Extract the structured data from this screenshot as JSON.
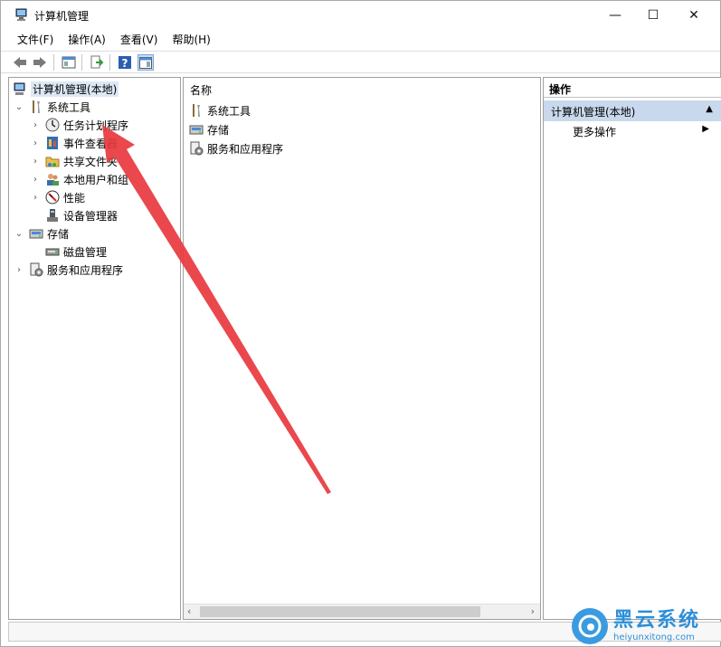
{
  "window": {
    "title": "计算机管理",
    "controls": {
      "minimize": "—",
      "maximize": "☐",
      "close": "✕"
    }
  },
  "menu": [
    "文件(F)",
    "操作(A)",
    "查看(V)",
    "帮助(H)"
  ],
  "tree": {
    "root": "计算机管理(本地)",
    "system_tools": "系统工具",
    "items": [
      "任务计划程序",
      "事件查看器",
      "共享文件夹",
      "本地用户和组",
      "性能",
      "设备管理器"
    ],
    "storage": "存储",
    "disk_management": "磁盘管理",
    "services": "服务和应用程序"
  },
  "list": {
    "header": "名称",
    "rows": [
      "系统工具",
      "存储",
      "服务和应用程序"
    ]
  },
  "actions": {
    "header": "操作",
    "section": "计算机管理(本地)",
    "more": "更多操作"
  },
  "watermark": {
    "title": "黑云系统",
    "url": "heiyunxitong.com"
  },
  "colors": {
    "selection": "#c9d9ed",
    "annotation_arrow": "#e8383d",
    "watermark": "#2d8fd8"
  }
}
